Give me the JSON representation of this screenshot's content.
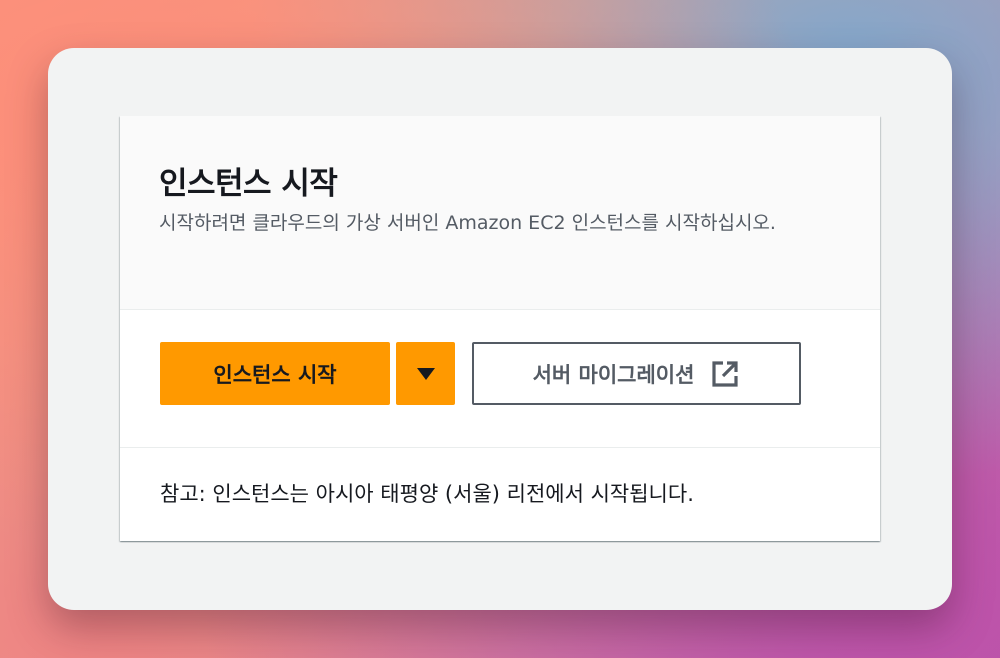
{
  "card": {
    "title": "인스턴스 시작",
    "description": "시작하려면 클라우드의 가상 서버인 Amazon EC2 인스턴스를 시작하십시오."
  },
  "actions": {
    "launch_label": "인스턴스 시작",
    "dropdown_icon": "caret-down-icon",
    "migration_label": "서버 마이그레이션",
    "migration_icon": "external-link-icon"
  },
  "footer": {
    "note": "참고: 인스턴스는 아시아 태평양 (서울) 리전에서 시작됩니다."
  },
  "colors": {
    "primary": "#ff9900",
    "text": "#16191f",
    "muted": "#545b64"
  }
}
